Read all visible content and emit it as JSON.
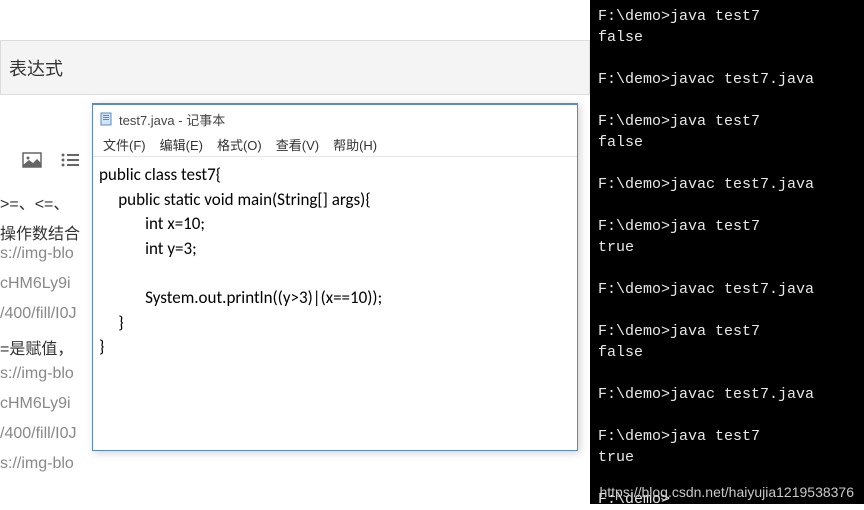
{
  "background": {
    "header_title": "表达式",
    "left_texts": [
      ">=、<=、",
      "操作数结合",
      "s://img-blo",
      "cHM6Ly9i",
      "/400/fill/I0J",
      "  =是赋值，",
      "s://img-blo",
      "cHM6Ly9i",
      "/400/fill/I0J",
      "s://img-blo"
    ]
  },
  "notepad": {
    "title": "test7.java - 记事本",
    "menu": {
      "file": "文件(F)",
      "edit": "编辑(E)",
      "format": "格式(O)",
      "view": "查看(V)",
      "help": "帮助(H)"
    },
    "code": "public class test7{\n     public static void main(String[] args){\n            int x=10;\n            int y=3;\n\n            System.out.println((y>3)|(x==10));\n     }\n}"
  },
  "terminal": {
    "lines": "F:\\demo>java test7\nfalse\n\nF:\\demo>javac test7.java\n\nF:\\demo>java test7\nfalse\n\nF:\\demo>javac test7.java\n\nF:\\demo>java test7\ntrue\n\nF:\\demo>javac test7.java\n\nF:\\demo>java test7\nfalse\n\nF:\\demo>javac test7.java\n\nF:\\demo>java test7\ntrue\n\nF:\\demo>"
  },
  "watermark": "https://blog.csdn.net/haiyujia1219538376"
}
